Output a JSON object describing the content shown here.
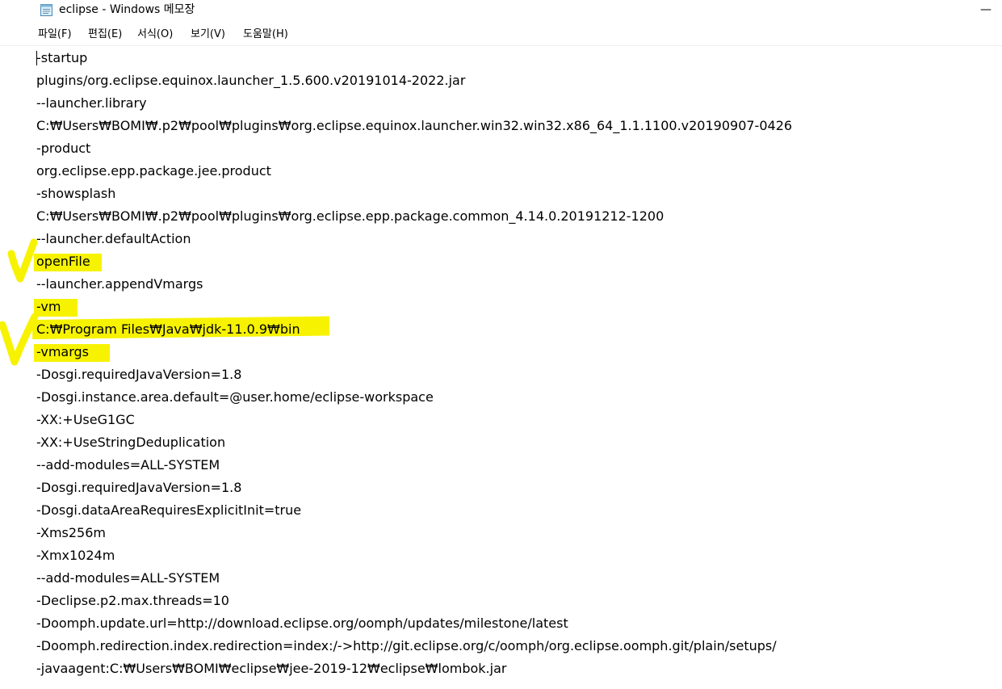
{
  "window": {
    "title": "eclipse - Windows 메모장",
    "app_icon": "notepad-icon",
    "minimize_icon": "minimize-icon",
    "minimize_glyph": "—"
  },
  "menu": {
    "items": [
      {
        "label": "파일(F)"
      },
      {
        "label": "편집(E)"
      },
      {
        "label": "서식(O)"
      },
      {
        "label": "보기(V)"
      },
      {
        "label": "도움말(H)"
      }
    ]
  },
  "highlight_color": "#f7f300",
  "annotation_marks": [
    "checkmark-annotation",
    "checkmark-annotation"
  ],
  "document": {
    "lines": [
      "-startup",
      "plugins/org.eclipse.equinox.launcher_1.5.600.v20191014-2022.jar",
      "--launcher.library",
      "C:₩Users₩BOMI₩.p2₩pool₩plugins₩org.eclipse.equinox.launcher.win32.win32.x86_64_1.1.1100.v20190907-0426",
      "-product",
      "org.eclipse.epp.package.jee.product",
      "-showsplash",
      "C:₩Users₩BOMI₩.p2₩pool₩plugins₩org.eclipse.epp.package.common_4.14.0.20191212-1200",
      "--launcher.defaultAction",
      "openFile",
      "--launcher.appendVmargs",
      "-vm",
      "C:₩Program Files₩Java₩jdk-11.0.9₩bin",
      "-vmargs",
      "-Dosgi.requiredJavaVersion=1.8",
      "-Dosgi.instance.area.default=@user.home/eclipse-workspace",
      "-XX:+UseG1GC",
      "-XX:+UseStringDeduplication",
      "--add-modules=ALL-SYSTEM",
      "-Dosgi.requiredJavaVersion=1.8",
      "-Dosgi.dataAreaRequiresExplicitInit=true",
      "-Xms256m",
      "-Xmx1024m",
      "--add-modules=ALL-SYSTEM",
      "-Declipse.p2.max.threads=10",
      "-Doomph.update.url=http://download.eclipse.org/oomph/updates/milestone/latest",
      "-Doomph.redirection.index.redirection=index:/->http://git.eclipse.org/c/oomph/org.eclipse.oomph.git/plain/setups/",
      "-javaagent:C:₩Users₩BOMI₩eclipse₩jee-2019-12₩eclipse₩lombok.jar"
    ]
  }
}
